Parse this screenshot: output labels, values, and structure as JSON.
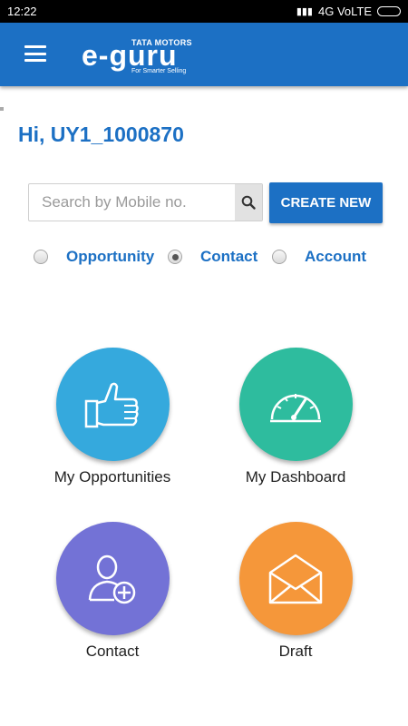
{
  "status_bar": {
    "time": "12:22",
    "network": "4G VoLTE"
  },
  "app_bar": {
    "brand_top": "TATA MOTORS",
    "brand_name": "e-guru",
    "tagline": "For Smarter Selling"
  },
  "greeting": "Hi, UY1_1000870",
  "search": {
    "placeholder": "Search by Mobile no.",
    "value": ""
  },
  "create_button": "CREATE NEW",
  "radio_options": [
    {
      "label": "Opportunity",
      "selected": false
    },
    {
      "label": "Contact",
      "selected": true
    },
    {
      "label": "Account",
      "selected": false
    }
  ],
  "tiles": [
    {
      "label": "My Opportunities",
      "color": "#35a9dd",
      "icon": "thumbs-up-icon"
    },
    {
      "label": "My Dashboard",
      "color": "#2ebc9e",
      "icon": "speedometer-icon"
    },
    {
      "label": "Contact",
      "color": "#7372d6",
      "icon": "add-contact-icon"
    },
    {
      "label": "Draft",
      "color": "#f5973a",
      "icon": "envelope-icon"
    }
  ]
}
